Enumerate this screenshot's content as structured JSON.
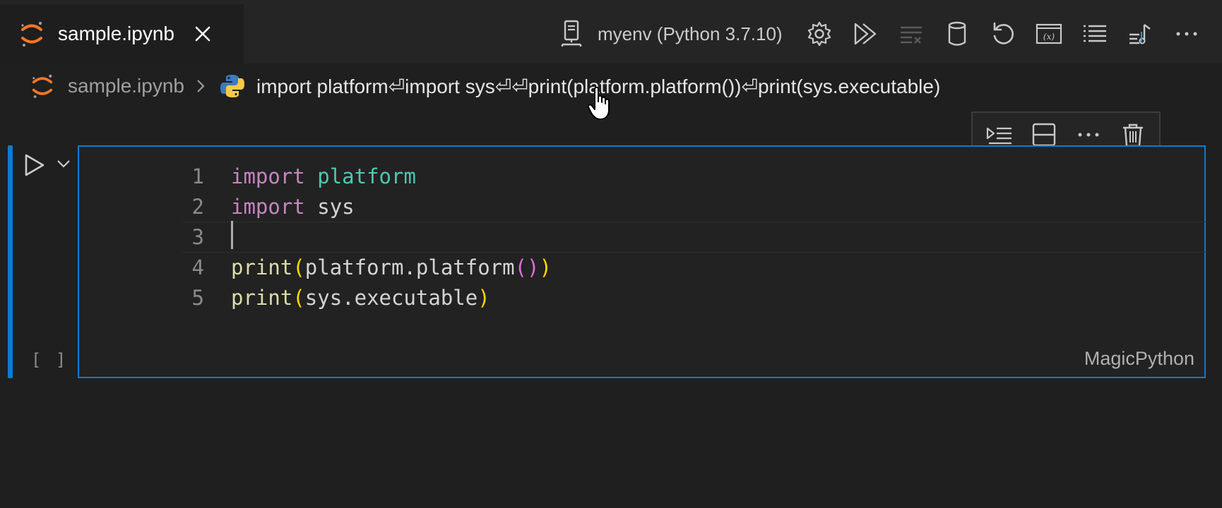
{
  "tab": {
    "title": "sample.ipynb",
    "close_icon": "close-icon",
    "logo_icon": "jupyter-icon"
  },
  "toolbar": {
    "kernel_label": "myenv (Python 3.7.10)",
    "kernel_icon": "server-icon",
    "buttons": [
      "settings-icon",
      "run-all-icon",
      "clear-outputs-icon",
      "variables-database-icon",
      "restart-icon",
      "variable-explorer-icon",
      "outline-icon",
      "export-icon",
      "more-icon"
    ]
  },
  "breadcrumb": {
    "file": "sample.ipynb",
    "code_preview": "import platform⏎import sys⏎⏎print(platform.platform())⏎print(sys.executable)"
  },
  "cell": {
    "language": "MagicPython",
    "execution_count": "[ ]",
    "lines": [
      {
        "n": "1",
        "tokens": [
          {
            "t": "import",
            "c": "kw"
          },
          {
            "t": " ",
            "c": "plain"
          },
          {
            "t": "platform",
            "c": "mod"
          }
        ]
      },
      {
        "n": "2",
        "tokens": [
          {
            "t": "import",
            "c": "kw"
          },
          {
            "t": " ",
            "c": "plain"
          },
          {
            "t": "sys",
            "c": "plain"
          }
        ]
      },
      {
        "n": "3",
        "tokens": []
      },
      {
        "n": "4",
        "tokens": [
          {
            "t": "print",
            "c": "fn"
          },
          {
            "t": "(",
            "c": "p1"
          },
          {
            "t": "platform.platform",
            "c": "plain"
          },
          {
            "t": "()",
            "c": "p2"
          },
          {
            "t": ")",
            "c": "p1"
          }
        ]
      },
      {
        "n": "5",
        "tokens": [
          {
            "t": "print",
            "c": "fn"
          },
          {
            "t": "(",
            "c": "p1"
          },
          {
            "t": "sys.executable",
            "c": "plain"
          },
          {
            "t": ")",
            "c": "p1"
          }
        ]
      }
    ]
  },
  "cell_toolbar": [
    "run-by-line-icon",
    "split-cell-icon",
    "more-icon",
    "delete-icon"
  ],
  "colors": {
    "accent": "#0e7ad3",
    "jupyter_orange": "#f37726",
    "keyword": "#c586c0",
    "module": "#4ec9b0",
    "function": "#dcdcaa"
  }
}
